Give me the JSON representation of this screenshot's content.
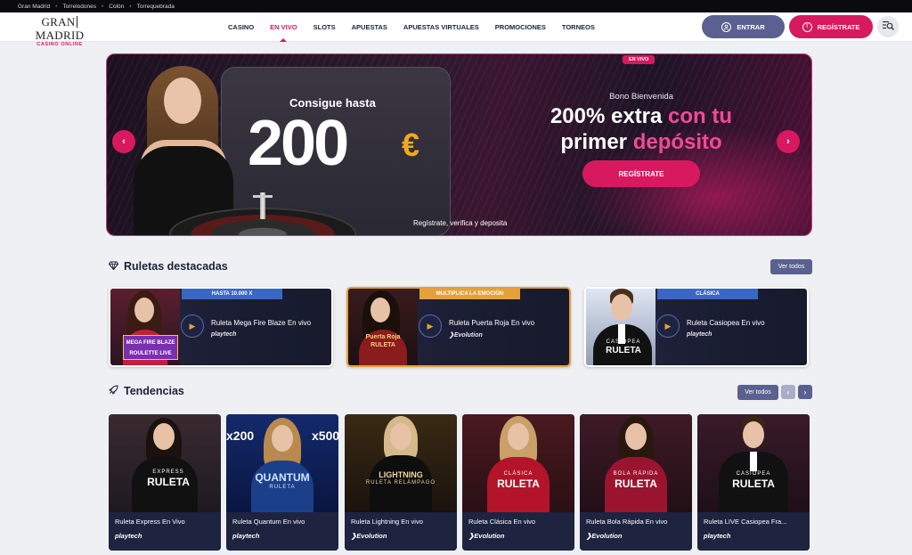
{
  "topbar": {
    "links": [
      "Gran Madrid",
      "Torrelodones",
      "Colón",
      "Torrequebrada"
    ]
  },
  "brand": {
    "name_left": "GRAN",
    "name_right": "MADRID",
    "tagline": "CASINO ONLINE",
    "accent": "#d8195f",
    "secondary": "#5a6190"
  },
  "nav": {
    "items": [
      "CASINO",
      "EN VIVO",
      "SLOTS",
      "APUESTAS",
      "APUESTAS VIRTUALES",
      "PROMOCIONES",
      "TORNEOS"
    ],
    "active": "EN VIVO",
    "login_label": "ENTRAR",
    "register_label": "REGÍSTRATE"
  },
  "hero": {
    "badge": "EN VIVO",
    "headline": "Consigue hasta",
    "amount": "200",
    "currency": "€",
    "bono": "Bono Bienvenida",
    "line1_white": "200% extra",
    "line1_pink": "con tu",
    "line2_white": "primer",
    "line2_pink": "depósito",
    "cta": "REGÍSTRATE",
    "footnote": "Regístrate, verifica y deposita"
  },
  "featured": {
    "title": "Ruletas destacadas",
    "see_all": "Ver todos",
    "cards": [
      {
        "tag": "HASTA 10.000 X",
        "name": "Ruleta Mega Fire Blaze En vivo",
        "provider": "playtech",
        "art": "MEGA FIRE BLAZE ROULETTE LIVE"
      },
      {
        "tag": "MULTIPLICA LA EMOCIÓN",
        "name": "Ruleta Puerta Roja En vivo",
        "provider": "Evolution",
        "art": "Puerta Roja RULETA"
      },
      {
        "tag": "CLÁSICA",
        "name": "Ruleta Casiopea En vivo",
        "provider": "playtech",
        "art_top": "CASIOPEA",
        "art": "RULETA"
      }
    ]
  },
  "trends": {
    "title": "Tendencias",
    "see_all": "Ver todos",
    "prev": "‹",
    "next": "›",
    "cards": [
      {
        "name": "Ruleta Express En Vivo",
        "provider": "playtech",
        "art_top": "EXPRESS",
        "art": "RULETA"
      },
      {
        "name": "Ruleta Quantum En vivo",
        "provider": "playtech",
        "art_top": "QUANTUM",
        "art": "RULETA",
        "promo_left": "x200",
        "promo_right": "x500"
      },
      {
        "name": "Ruleta Lightning En vivo",
        "provider": "Evolution",
        "art_top": "LIGHTNING",
        "art": "RULETA RELÁMPAGO"
      },
      {
        "name": "Ruleta Clásica En vivo",
        "provider": "Evolution",
        "art_top": "CLÁSICA",
        "art": "RULETA"
      },
      {
        "name": "Ruleta Bola Rápida En vivo",
        "provider": "Evolution",
        "art_top": "BOLA RÁPIDA",
        "art": "RULETA"
      },
      {
        "name": "Ruleta LIVE Casiopea Fra...",
        "provider": "playtech",
        "art_top": "CASIOPEA",
        "art": "RULETA"
      }
    ]
  }
}
